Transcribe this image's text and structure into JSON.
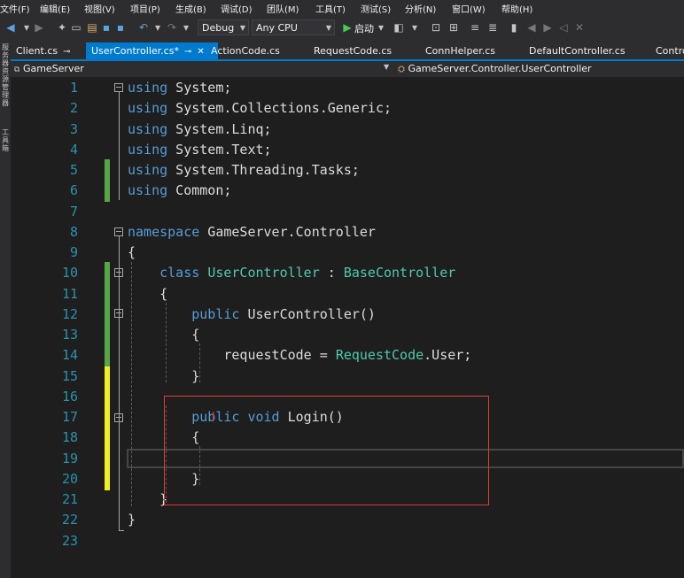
{
  "menu": [
    "文件(F)",
    "编辑(E)",
    "视图(V)",
    "项目(P)",
    "生成(B)",
    "调试(D)",
    "团队(M)",
    "工具(T)",
    "测试(S)",
    "分析(N)",
    "窗口(W)",
    "帮助(H)"
  ],
  "toolbar": {
    "configuration": "Debug",
    "platform": "Any CPU",
    "start_label": "启动"
  },
  "left_strip": {
    "top_label": "服务器资源管理器",
    "bottom_label": "工具箱"
  },
  "tabs": [
    {
      "label": "Client.cs",
      "active": false
    },
    {
      "label": "UserController.cs*",
      "active": true
    },
    {
      "label": "ActionCode.cs",
      "active": false
    },
    {
      "label": "RequestCode.cs",
      "active": false
    },
    {
      "label": "ConnHelper.cs",
      "active": false
    },
    {
      "label": "DefaultController.cs",
      "active": false
    },
    {
      "label": "Contro",
      "active": false
    }
  ],
  "navbar": {
    "project": "GameServer",
    "class_path": "GameServer.Controller.UserController"
  },
  "editor": {
    "line_numbers": [
      "1",
      "2",
      "3",
      "4",
      "5",
      "6",
      "7",
      "8",
      "9",
      "10",
      "11",
      "12",
      "13",
      "14",
      "15",
      "16",
      "17",
      "18",
      "19",
      "20",
      "21",
      "22",
      "23"
    ],
    "lines": [
      [
        {
          "t": "using",
          "c": "kw"
        },
        {
          "t": " System;",
          "c": "id"
        }
      ],
      [
        {
          "t": "using",
          "c": "kw"
        },
        {
          "t": " System.Collections.Generic;",
          "c": "id"
        }
      ],
      [
        {
          "t": "using",
          "c": "kw"
        },
        {
          "t": " System.Linq;",
          "c": "id"
        }
      ],
      [
        {
          "t": "using",
          "c": "kw"
        },
        {
          "t": " System.Text;",
          "c": "id"
        }
      ],
      [
        {
          "t": "using",
          "c": "kw"
        },
        {
          "t": " System.Threading.Tasks;",
          "c": "id"
        }
      ],
      [
        {
          "t": "using",
          "c": "kw"
        },
        {
          "t": " Common;",
          "c": "id"
        }
      ],
      [],
      [
        {
          "t": "namespace",
          "c": "kw"
        },
        {
          "t": " GameServer.Controller",
          "c": "id"
        }
      ],
      [
        {
          "t": "{",
          "c": "id"
        }
      ],
      [
        {
          "t": "    ",
          "c": "id"
        },
        {
          "t": "class",
          "c": "kw"
        },
        {
          "t": " ",
          "c": "id"
        },
        {
          "t": "UserController",
          "c": "ty"
        },
        {
          "t": " : ",
          "c": "id"
        },
        {
          "t": "BaseController",
          "c": "ty"
        }
      ],
      [
        {
          "t": "    {",
          "c": "id"
        }
      ],
      [
        {
          "t": "        ",
          "c": "id"
        },
        {
          "t": "public",
          "c": "kw"
        },
        {
          "t": " UserController()",
          "c": "id"
        }
      ],
      [
        {
          "t": "        {",
          "c": "id"
        }
      ],
      [
        {
          "t": "            requestCode = ",
          "c": "id"
        },
        {
          "t": "RequestCode",
          "c": "ty"
        },
        {
          "t": ".User;",
          "c": "id"
        }
      ],
      [
        {
          "t": "        }",
          "c": "id"
        }
      ],
      [],
      [
        {
          "t": "        ",
          "c": "id"
        },
        {
          "t": "public",
          "c": "kw"
        },
        {
          "t": " ",
          "c": "id"
        },
        {
          "t": "void",
          "c": "kw"
        },
        {
          "t": " Login()",
          "c": "id"
        }
      ],
      [
        {
          "t": "        {",
          "c": "id"
        }
      ],
      [],
      [
        {
          "t": "        }",
          "c": "id"
        }
      ],
      [
        {
          "t": "    }",
          "c": "id"
        }
      ],
      [
        {
          "t": "}",
          "c": "id"
        }
      ],
      []
    ]
  },
  "colors": {
    "accent": "#007acc",
    "keyword": "#569cd6",
    "type": "#4ec9b0",
    "line_number": "#2b91af",
    "change_saved": "#57a64a",
    "change_unsaved": "#efef22",
    "highlight_box": "#e03a3a"
  }
}
